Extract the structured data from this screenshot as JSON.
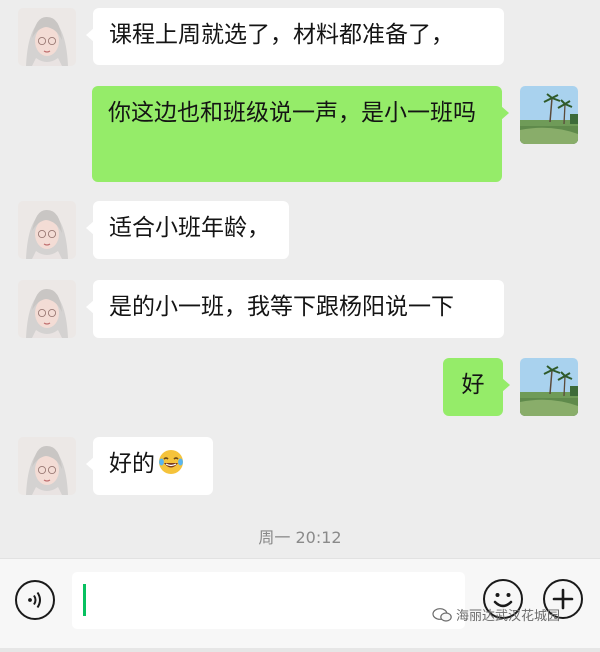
{
  "messages": [
    {
      "side": "left",
      "text": "课程上周就选了，材料都准备了，",
      "avatar": "anime-girl-avatar"
    },
    {
      "side": "right",
      "text": "你这边也和班级说一声，是小一班吗",
      "avatar": "palm-beach-avatar"
    },
    {
      "side": "left",
      "text": "适合小班年龄，",
      "avatar": "anime-girl-avatar"
    },
    {
      "side": "left",
      "text": "是的小一班，我等下跟杨阳说一下",
      "avatar": "anime-girl-avatar"
    },
    {
      "side": "right",
      "text": "好",
      "avatar": "palm-beach-avatar"
    },
    {
      "side": "left",
      "text": "好的",
      "emoji": "laughing-tears-emoji",
      "avatar": "anime-girl-avatar"
    }
  ],
  "timestamp": "周一 20:12",
  "input_bar": {
    "value": "",
    "voice_icon": "voice-icon",
    "emoji_icon": "smiley-face-icon",
    "plus_icon": "plus-icon"
  },
  "watermark": "海丽达武汉花城园",
  "colors": {
    "background": "#ededed",
    "incoming_bubble": "#ffffff",
    "outgoing_bubble": "#95ec69",
    "caret": "#07c160"
  }
}
